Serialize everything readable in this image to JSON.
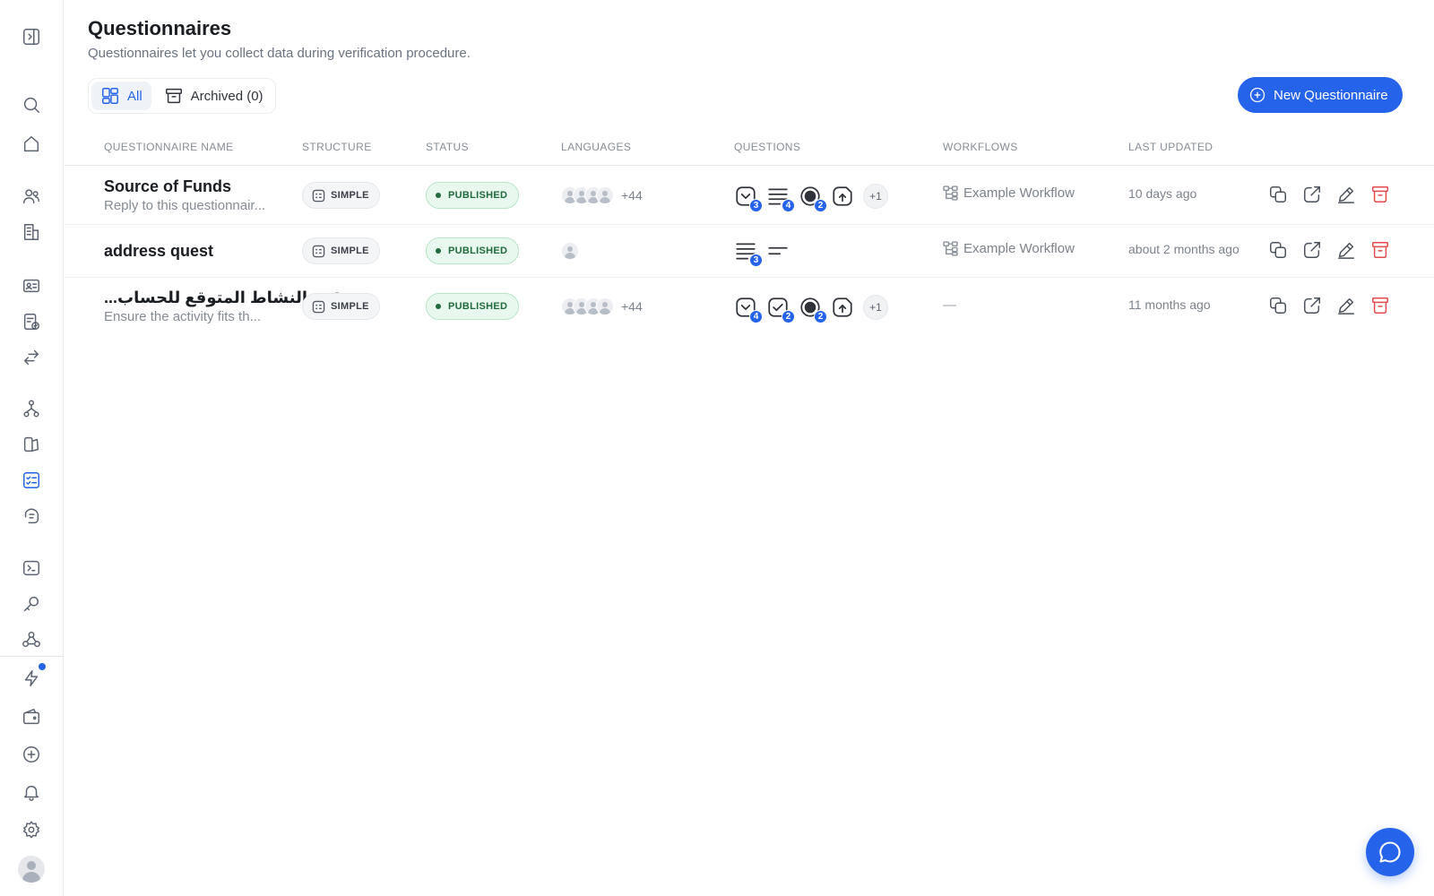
{
  "header": {
    "title": "Questionnaires",
    "subtitle": "Questionnaires let you collect data during verification procedure."
  },
  "tabs": [
    {
      "label": "All",
      "active": true,
      "icon": "grid-icon"
    },
    {
      "label": "Archived (0)",
      "active": false,
      "icon": "archive-icon"
    }
  ],
  "new_button": {
    "label": "New Questionnaire"
  },
  "columns": {
    "name": "QUESTIONNAIRE NAME",
    "structure": "STRUCTURE",
    "status": "STATUS",
    "languages": "LANGUAGES",
    "questions": "QUESTIONS",
    "workflows": "WORKFLOWS",
    "updated": "LAST UPDATED"
  },
  "rows": [
    {
      "name": "Source of Funds",
      "description": "Reply to this questionnair...",
      "structure": "SIMPLE",
      "status": "PUBLISHED",
      "languages_more": "+44",
      "questions_more": "+1",
      "question_counts": [
        "3",
        "4",
        "2"
      ],
      "workflow": "Example Workflow",
      "updated": "10 days ago"
    },
    {
      "name": "address quest",
      "description": "",
      "structure": "SIMPLE",
      "status": "PUBLISHED",
      "languages_more": "",
      "question_counts": [
        "3"
      ],
      "workflow": "Example Workflow",
      "updated": "about 2 months ago"
    },
    {
      "name": "...قة والنشاط المتوقع للحساب",
      "description": "Ensure the activity fits th...",
      "structure": "SIMPLE",
      "status": "PUBLISHED",
      "languages_more": "+44",
      "questions_more": "+1",
      "question_counts": [
        "4",
        "2",
        "2"
      ],
      "workflow": "—",
      "updated": "11 months ago"
    }
  ],
  "colors": {
    "accent": "#2563eb",
    "published_bg": "#e9f8ee",
    "published_text": "#1f6b3d",
    "danger": "#e5484d"
  }
}
